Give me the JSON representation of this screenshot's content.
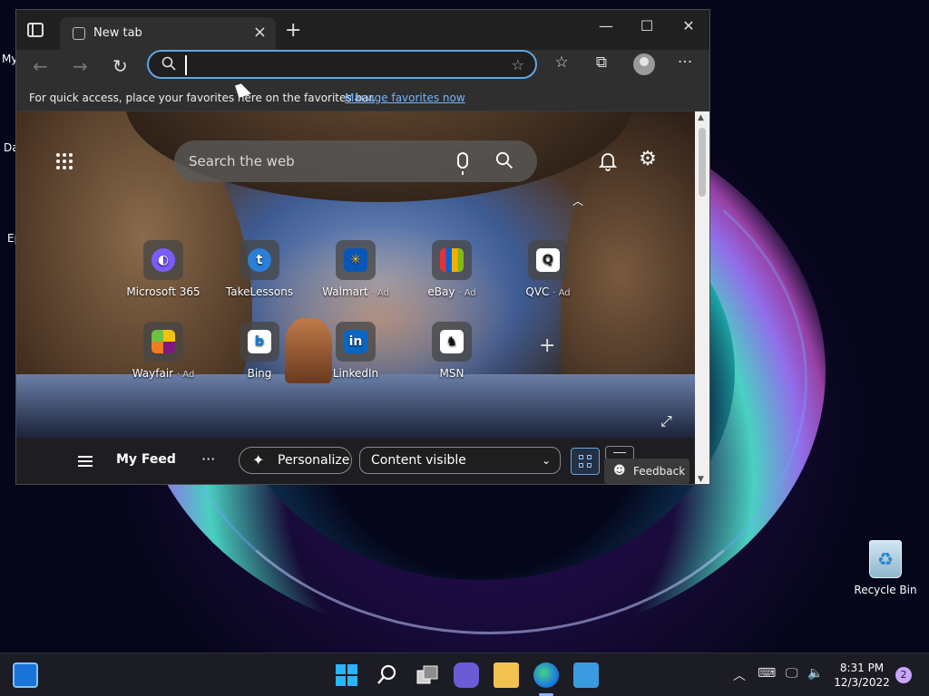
{
  "desktop": {
    "partial_labels": [
      "My",
      "Da",
      "Ep"
    ],
    "recycle_bin": "Recycle Bin"
  },
  "browser": {
    "tab_title": "New tab",
    "favorites_bar": {
      "message": "For quick access, place your favorites here on the favorites bar.",
      "link": "Manage favorites now"
    },
    "address": {
      "value": ""
    }
  },
  "newtab": {
    "search_placeholder": "Search the web",
    "tiles": [
      {
        "label": "Microsoft 365",
        "ad": "",
        "icon": "microsoft-365-icon",
        "color": "#7a5cff"
      },
      {
        "label": "TakeLessons",
        "ad": "",
        "icon": "takelessons-icon",
        "color": "#2a7fd6"
      },
      {
        "label": "Walmart",
        "ad": "Ad",
        "icon": "walmart-icon",
        "color": "#0a56b8"
      },
      {
        "label": "eBay",
        "ad": "Ad",
        "icon": "ebay-icon",
        "color": "#e53238"
      },
      {
        "label": "QVC",
        "ad": "Ad",
        "icon": "qvc-icon",
        "color": "#ffffff"
      },
      {
        "label": "Wayfair",
        "ad": "Ad",
        "icon": "wayfair-icon",
        "color": "#7f187f"
      },
      {
        "label": "Bing",
        "ad": "",
        "icon": "bing-icon",
        "color": "#ffffff"
      },
      {
        "label": "LinkedIn",
        "ad": "",
        "icon": "linkedin-icon",
        "color": "#0a66c2"
      },
      {
        "label": "MSN",
        "ad": "",
        "icon": "msn-icon",
        "color": "#ffffff"
      }
    ],
    "feed": {
      "title": "My Feed",
      "personalize": "Personalize",
      "content_select": "Content visible",
      "feedback": "Feedback"
    }
  },
  "taskbar": {
    "time": "8:31 PM",
    "date": "12/3/2022",
    "notification_count": "2"
  }
}
